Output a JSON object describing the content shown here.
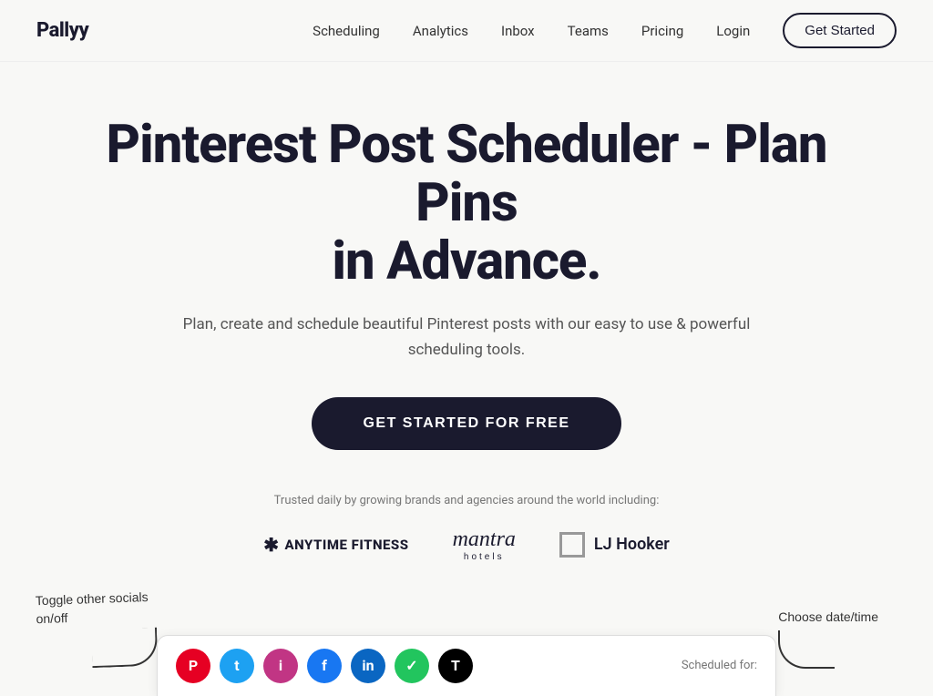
{
  "nav": {
    "logo": "Pallyy",
    "links": [
      {
        "label": "Scheduling",
        "id": "scheduling"
      },
      {
        "label": "Analytics",
        "id": "analytics"
      },
      {
        "label": "Inbox",
        "id": "inbox"
      },
      {
        "label": "Teams",
        "id": "teams"
      },
      {
        "label": "Pricing",
        "id": "pricing"
      },
      {
        "label": "Login",
        "id": "login"
      }
    ],
    "cta_label": "Get Started"
  },
  "hero": {
    "heading_line1": "Pinterest Post Scheduler - Plan Pins",
    "heading_line2": "in Advance.",
    "subtext": "Plan, create and schedule beautiful Pinterest posts with our easy to use & powerful scheduling tools.",
    "cta_label": "GET STARTED FOR FREE"
  },
  "trusted": {
    "label": "Trusted daily by growing brands and agencies around the world including:",
    "brands": [
      {
        "name": "ANYTIME FITNESS",
        "id": "anytime"
      },
      {
        "name": "mantra hotels",
        "id": "mantra"
      },
      {
        "name": "LJ Hooker",
        "id": "ljhooker"
      }
    ]
  },
  "annotations": {
    "left": "Toggle other socials on/off",
    "right": "Choose date/time"
  },
  "app_preview": {
    "scheduled_label": "Scheduled for:",
    "social_icons": [
      "p",
      "t",
      "i",
      "f",
      "in",
      "✓",
      "t"
    ]
  }
}
